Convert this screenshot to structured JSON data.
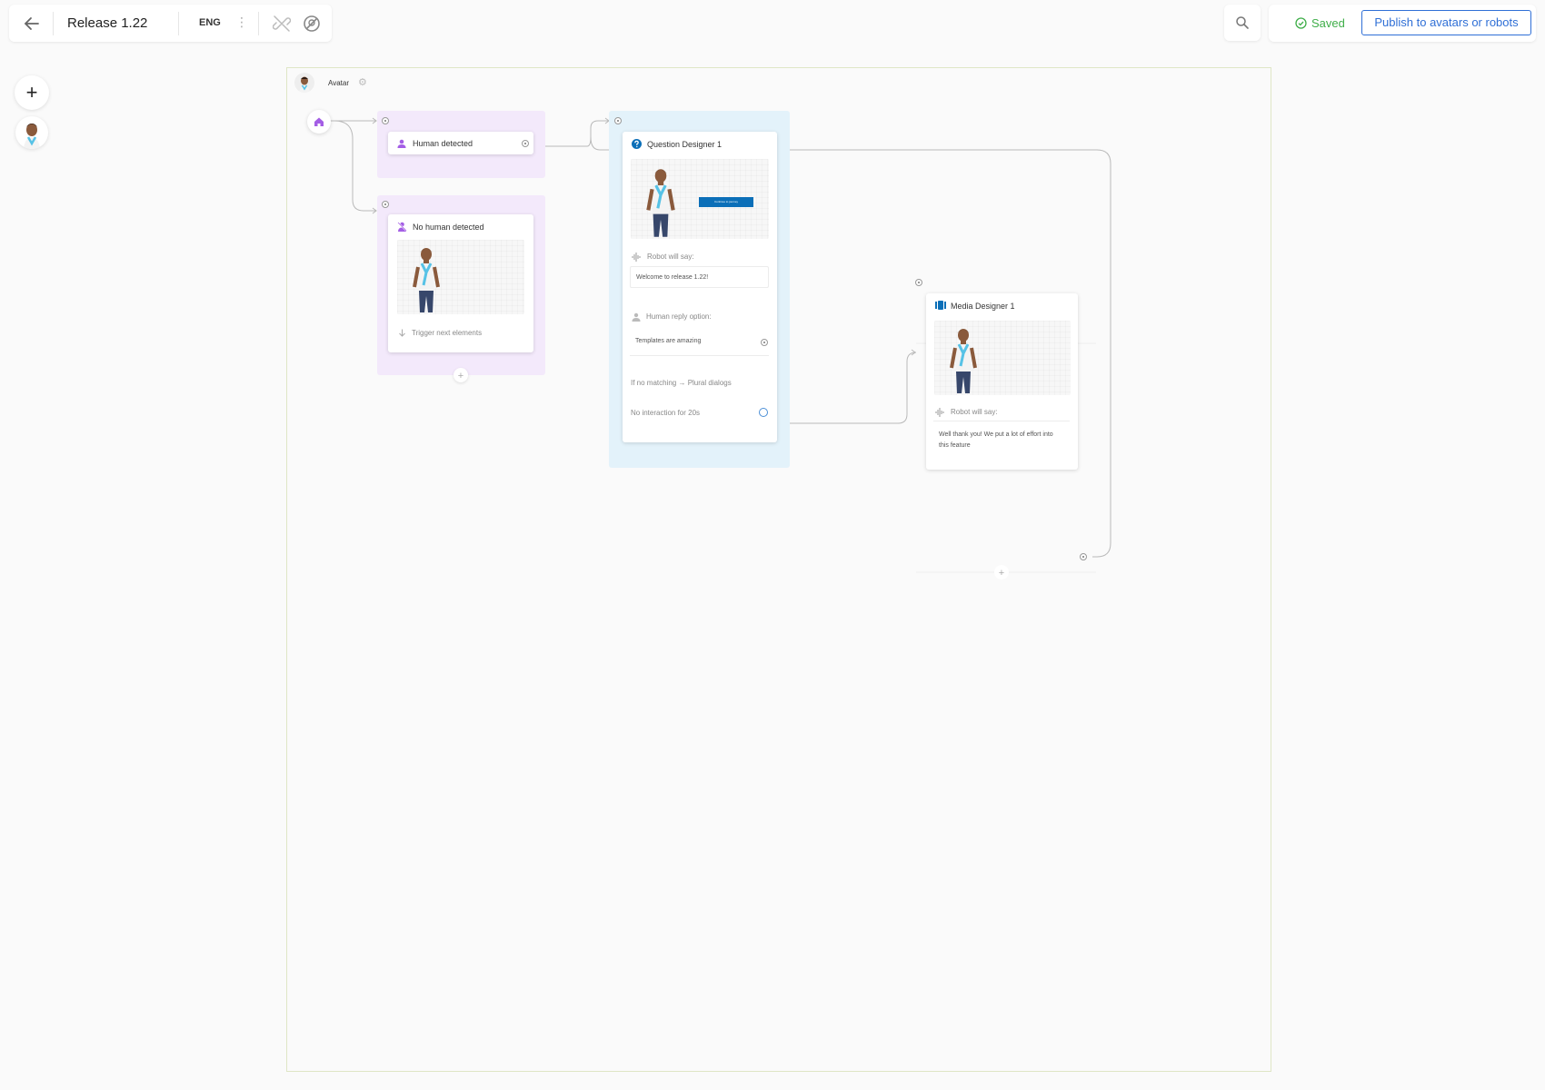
{
  "toolbar": {
    "title": "Release 1.22",
    "language": "ENG",
    "more": "⋮",
    "saved": "Saved",
    "publish": "Publish to avatars or robots"
  },
  "rail": {
    "add": "+"
  },
  "canvas": {
    "avatar_label": "Avatar",
    "gear": "⚙"
  },
  "nodes": {
    "human_detected": {
      "title": "Human detected"
    },
    "no_human_detected": {
      "title": "No human detected",
      "trigger": "Trigger next elements",
      "add": "+"
    },
    "question_designer": {
      "title": "Question Designer 1",
      "robot_will_say_label": "Robot will say:",
      "robot_will_say_text": "Welcome to release 1.22!",
      "human_reply_label": "Human reply option:",
      "human_reply_text": "Templates are amazing",
      "no_matching": "If no matching → Plural dialogs",
      "no_interaction": "No interaction for 20s",
      "preview_button": "Continue to journey"
    },
    "media_designer": {
      "title": "Media Designer 1",
      "robot_will_say_label": "Robot will say:",
      "robot_will_say_text": "Well thank you! We put a lot of effort into this feature",
      "add": "+"
    }
  },
  "colors": {
    "accent_blue": "#2f6fd6",
    "saved_green": "#3fae49",
    "trigger_purple": "#a45ee5",
    "question_blue": "#0b6fb8"
  }
}
